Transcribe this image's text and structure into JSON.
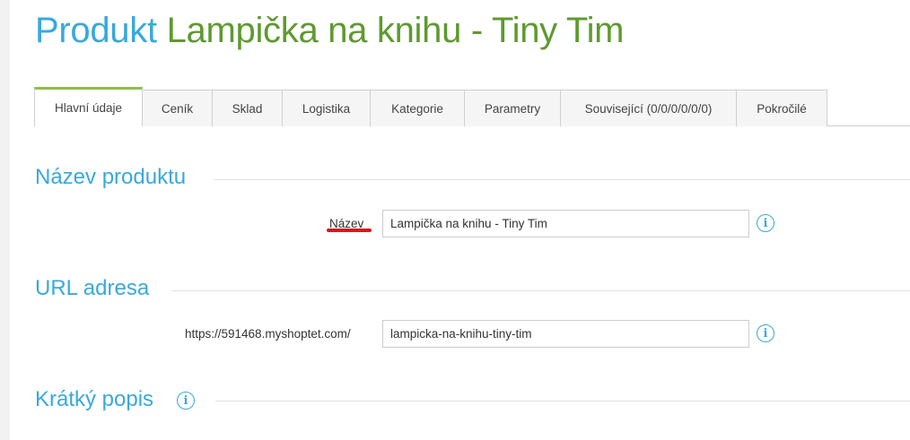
{
  "title": {
    "prefix": "Produkt",
    "product_name": "Lampička na knihu - Tiny Tim"
  },
  "tabs": [
    {
      "label": "Hlavní údaje",
      "active": true
    },
    {
      "label": "Ceník",
      "active": false
    },
    {
      "label": "Sklad",
      "active": false
    },
    {
      "label": "Logistika",
      "active": false
    },
    {
      "label": "Kategorie",
      "active": false
    },
    {
      "label": "Parametry",
      "active": false
    },
    {
      "label": "Související (0/0/0/0/0/0)",
      "active": false
    },
    {
      "label": "Pokročilé",
      "active": false
    }
  ],
  "sections": {
    "name": {
      "title": "Název produktu",
      "field_label": "Název",
      "value": "Lampička na knihu - Tiny Tim",
      "info_icon": "info-icon"
    },
    "url": {
      "title": "URL adresa",
      "prefix": "https://591468.myshoptet.com/",
      "value": "lampicka-na-knihu-tiny-tim",
      "info_icon": "info-icon"
    },
    "short_description": {
      "title": "Krátký popis",
      "info_icon": "info-icon"
    }
  },
  "colors": {
    "accent_blue": "#39a9db",
    "product_green": "#5e9a2f",
    "active_tab_border": "#8dc044",
    "highlight_underline": "#d01c1c"
  }
}
